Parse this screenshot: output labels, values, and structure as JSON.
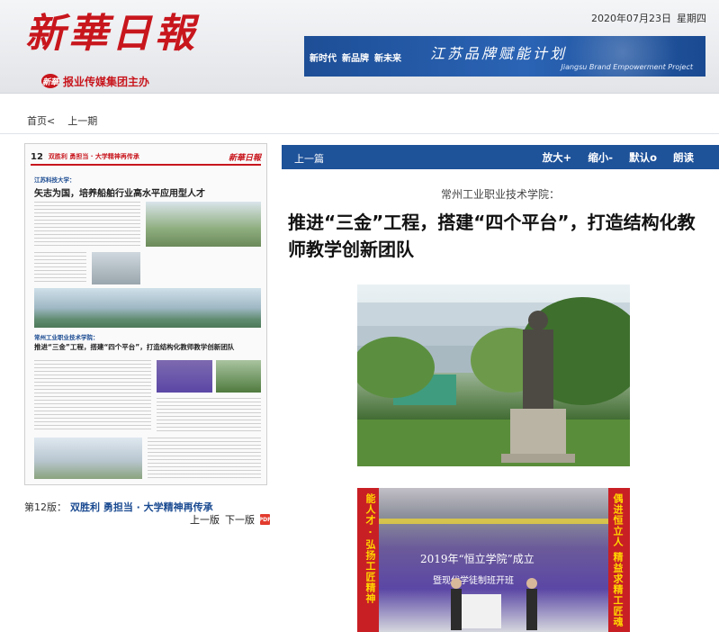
{
  "header": {
    "logo_title": "新華日報",
    "logo_mark": "新華",
    "logo_sub": "报业传媒集团主办",
    "date": "2020年07月23日",
    "weekday": "星期四",
    "banner": {
      "slogans": [
        "新时代",
        "新品牌",
        "新未来"
      ],
      "title": "江苏品牌赋能计划",
      "subtitle_en": "Jiangsu Brand Empowerment Project"
    }
  },
  "breadcrumb": {
    "home": "首页<",
    "prev_issue": "上一期"
  },
  "newspaper_page": {
    "page_number": "12",
    "header_tags": "双胜利 勇担当 · 大学精神再传承",
    "header_logo": "新華日報",
    "story1_kicker": "江苏科技大学：",
    "story1_headline": "矢志为国，培养船舶行业高水平应用型人才",
    "story2_kicker": "常州工业职业技术学院：",
    "story2_headline": "推进“三金”工程，搭建“四个平台”，打造结构化教师教学创新团队",
    "page_label_num": "第12版：",
    "page_label_title": "双胜利 勇担当 · 大学精神再传承",
    "prev_page": "上一版",
    "next_page": "下一版"
  },
  "toolbar": {
    "prev_article": "上一篇",
    "zoom_in": "放大+",
    "zoom_out": "缩小-",
    "default": "默认o",
    "read_aloud": "朗读"
  },
  "article": {
    "subtitle": "常州工业职业技术学院：",
    "title": "推进“三金”工程，搭建“四个平台”，打造结构化教师教学创新团队"
  },
  "photo2": {
    "banner_line1": "2019年“恒立学院”成立",
    "banner_line2": "暨现代学徒制班开班",
    "left_vertical": "能人才 · 弘扬工匠精神",
    "right_vertical": "偶进恒立人 精益求精工匠魂"
  },
  "colors": {
    "brand_red": "#c8161d",
    "toolbar_blue": "#1e5299"
  }
}
